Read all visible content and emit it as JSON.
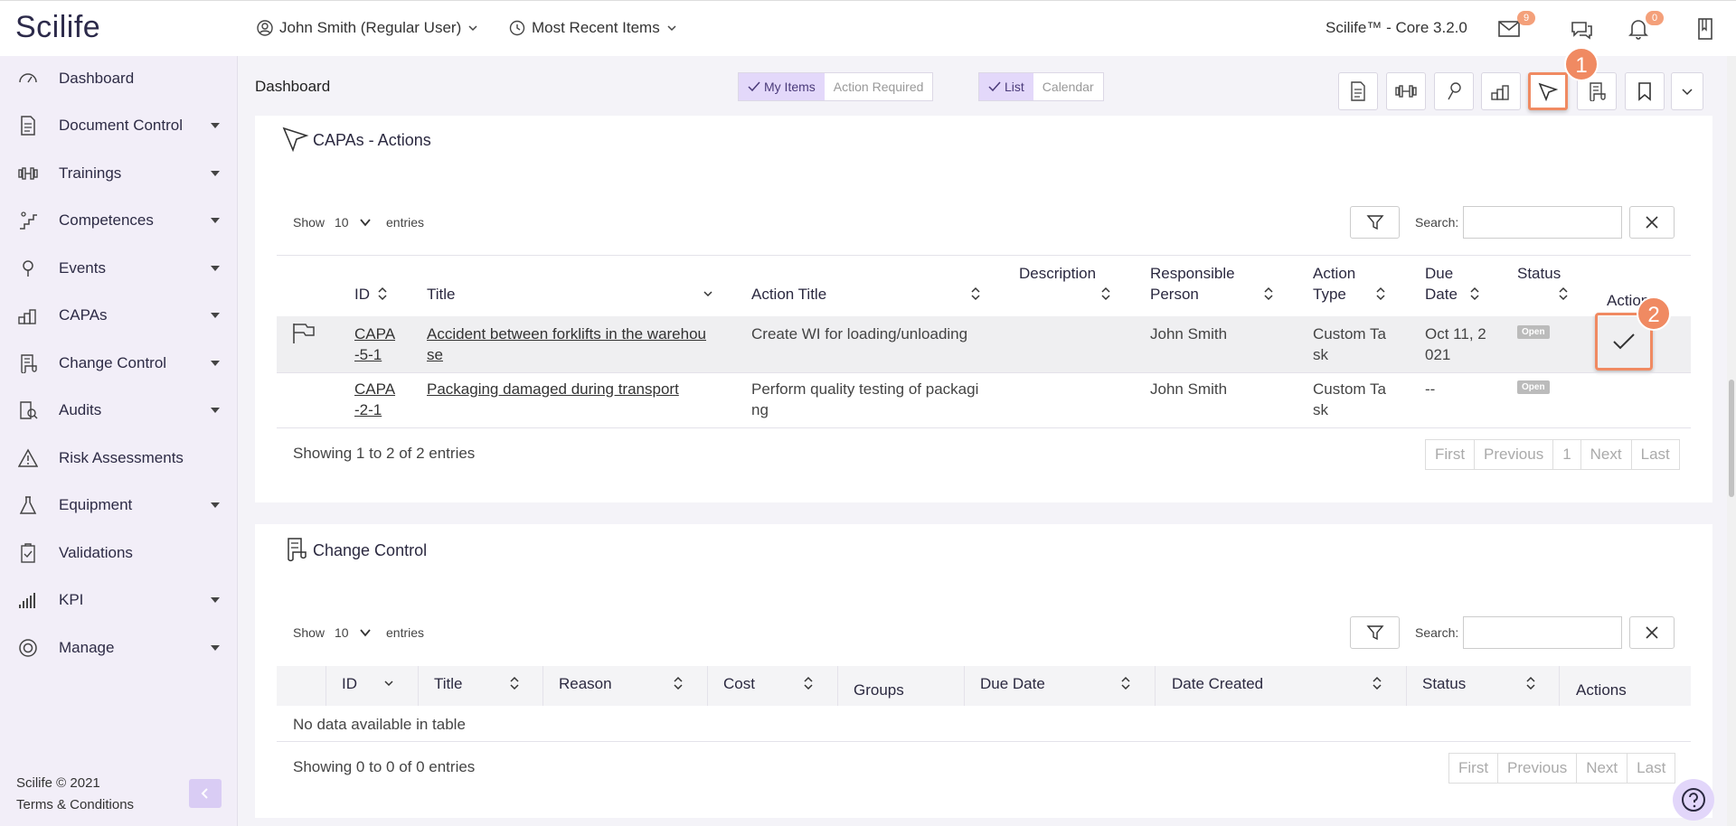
{
  "app": {
    "logo": "Scilife",
    "user_menu": "John Smith (Regular User)",
    "recent_menu": "Most Recent Items",
    "version": "Scilife™ - Core 3.2.0",
    "mail_count": "9",
    "notif_count": "0"
  },
  "sidebar": {
    "items": [
      {
        "label": "Dashboard",
        "icon": "gauge-icon"
      },
      {
        "label": "Document Control",
        "icon": "document-icon"
      },
      {
        "label": "Trainings",
        "icon": "dumbbell-icon"
      },
      {
        "label": "Competences",
        "icon": "stairs-icon"
      },
      {
        "label": "Events",
        "icon": "pin-icon"
      },
      {
        "label": "CAPAs",
        "icon": "steps-icon"
      },
      {
        "label": "Change Control",
        "icon": "scroll-icon"
      },
      {
        "label": "Audits",
        "icon": "audit-icon"
      },
      {
        "label": "Risk Assessments",
        "icon": "warning-icon"
      },
      {
        "label": "Equipment",
        "icon": "flask-icon"
      },
      {
        "label": "Validations",
        "icon": "clipboard-icon"
      },
      {
        "label": "KPI",
        "icon": "barchart-icon"
      },
      {
        "label": "Manage",
        "icon": "target-icon"
      }
    ],
    "copyright": "Scilife © 2021",
    "terms": "Terms & Conditions"
  },
  "subheader": {
    "title": "Dashboard",
    "my_items": "My Items",
    "action_required": "Action Required",
    "list": "List",
    "calendar": "Calendar",
    "callout_1": "1",
    "callout_2": "2"
  },
  "capa_panel": {
    "title": "CAPAs - Actions",
    "show": "Show",
    "entries_value": "10",
    "entries": "entries",
    "search_label": "Search:",
    "headers": {
      "id": "ID",
      "title": "Title",
      "action_title": "Action Title",
      "description": "Description",
      "responsible_1": "Responsible",
      "responsible_2": "Person",
      "action_type_1": "Action",
      "action_type_2": "Type",
      "due_1": "Due",
      "due_2": "Date",
      "status": "Status",
      "actions": "Actions"
    },
    "rows": [
      {
        "id_1": "CAPA",
        "id_2": "-5-1",
        "title_1": "Accident between forklifts in the warehou",
        "title_2": "se",
        "action_title_1": "Create WI for loading/unloading",
        "action_title_2": "",
        "responsible": "John Smith",
        "type_1": "Custom Ta",
        "type_2": "sk",
        "due_1": "Oct 11, 2",
        "due_2": "021",
        "status": "Open"
      },
      {
        "id_1": "CAPA",
        "id_2": "-2-1",
        "title_1": "Packaging damaged during transport",
        "title_2": "",
        "action_title_1": "Perform quality testing of packagi",
        "action_title_2": "ng",
        "responsible": "John Smith",
        "type_1": "Custom Ta",
        "type_2": "sk",
        "due_1": "--",
        "due_2": "",
        "status": "Open"
      }
    ],
    "showing": "Showing 1 to 2 of 2 entries",
    "pager": {
      "first": "First",
      "previous": "Previous",
      "page": "1",
      "next": "Next",
      "last": "Last"
    }
  },
  "cc_panel": {
    "title": "Change Control",
    "show": "Show",
    "entries_value": "10",
    "entries": "entries",
    "search_label": "Search:",
    "headers": {
      "id": "ID",
      "title": "Title",
      "reason": "Reason",
      "cost": "Cost",
      "groups": "Groups",
      "due_date": "Due Date",
      "date_created": "Date Created",
      "status": "Status",
      "actions": "Actions"
    },
    "empty": "No data available in table",
    "showing": "Showing 0 to 0 of 0 entries",
    "pager": {
      "first": "First",
      "previous": "Previous",
      "next": "Next",
      "last": "Last"
    }
  }
}
